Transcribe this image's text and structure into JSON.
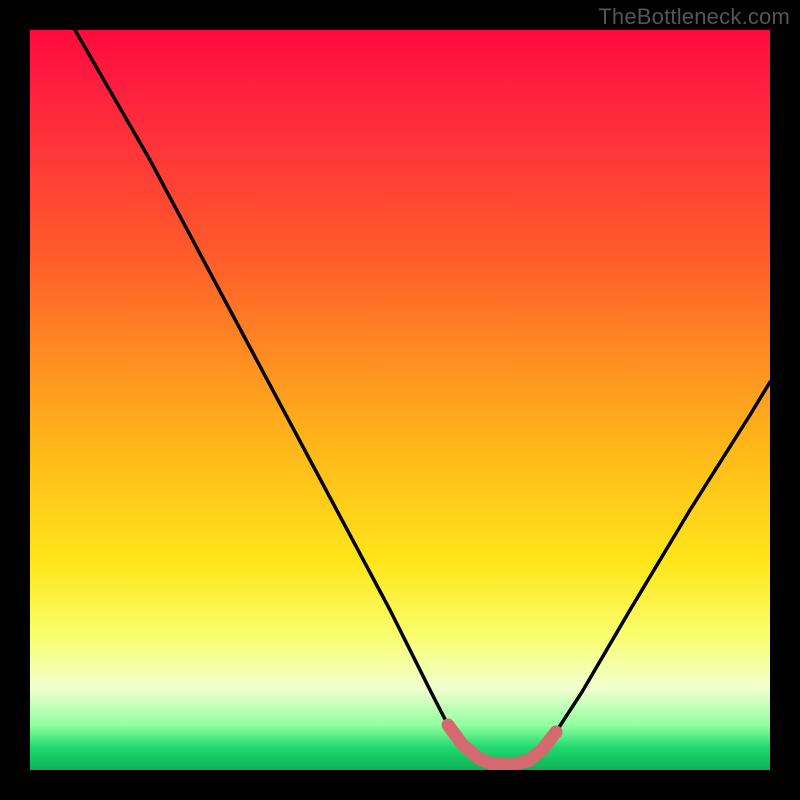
{
  "watermark": "TheBottleneck.com",
  "colors": {
    "frame_border": "#000000",
    "curve_stroke": "#000000",
    "highlight_stroke": "#d46a6e",
    "gradient_top": "#ff0a3c",
    "gradient_bottom": "#0fb257"
  },
  "chart_data": {
    "type": "line",
    "title": "",
    "xlabel": "",
    "ylabel": "",
    "xlim": [
      0,
      100
    ],
    "ylim": [
      0,
      100
    ],
    "x": [
      0,
      5,
      10,
      15,
      20,
      25,
      30,
      35,
      40,
      45,
      50,
      52,
      55,
      58,
      60,
      62,
      64,
      66,
      70,
      75,
      80,
      85,
      90,
      95,
      100
    ],
    "values": [
      100,
      94,
      87.5,
      80,
      72,
      64,
      55.5,
      47,
      38,
      29,
      19,
      14,
      8,
      3,
      1,
      0.5,
      0.5,
      1,
      4,
      10,
      18,
      26,
      35,
      44,
      53
    ],
    "highlight_range_x": [
      55,
      70
    ],
    "notes": "Values indicate distance from optimal (0 at bottom, 100 at top). Curve drops from near 100 on the left to a flat minimum around x≈60–65, then rises again toward the right. A short salmon-colored thick overlay marks the bottom of the valley."
  }
}
